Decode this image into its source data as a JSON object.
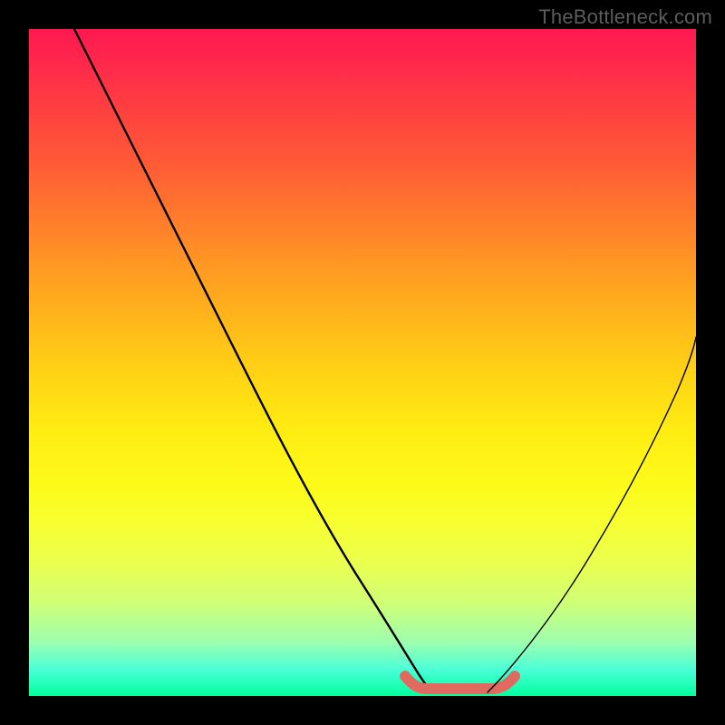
{
  "watermark": "TheBottleneck.com",
  "chart_data": {
    "type": "line",
    "title": "",
    "xlabel": "",
    "ylabel": "",
    "xlim": [
      0,
      100
    ],
    "ylim": [
      0,
      100
    ],
    "grid": false,
    "legend": false,
    "background": "vertical-gradient red-yellow-green",
    "series": [
      {
        "name": "left-descending-curve",
        "x": [
          10,
          15,
          20,
          25,
          30,
          35,
          40,
          45,
          50,
          55,
          58,
          60
        ],
        "y": [
          100,
          92,
          82,
          72,
          62,
          52,
          42,
          32,
          22,
          12,
          6,
          2
        ]
      },
      {
        "name": "right-ascending-curve",
        "x": [
          70,
          74,
          78,
          82,
          86,
          90,
          94,
          98,
          100
        ],
        "y": [
          2,
          6,
          12,
          20,
          30,
          42,
          54,
          64,
          70
        ]
      },
      {
        "name": "bottom-flat-highlight",
        "x": [
          56,
          58,
          60,
          62,
          64,
          66,
          68,
          70,
          72
        ],
        "y": [
          3,
          1.5,
          1,
          1,
          1,
          1,
          1,
          1.5,
          3
        ],
        "color": "#e06a60",
        "stroke_width": 12
      }
    ]
  }
}
